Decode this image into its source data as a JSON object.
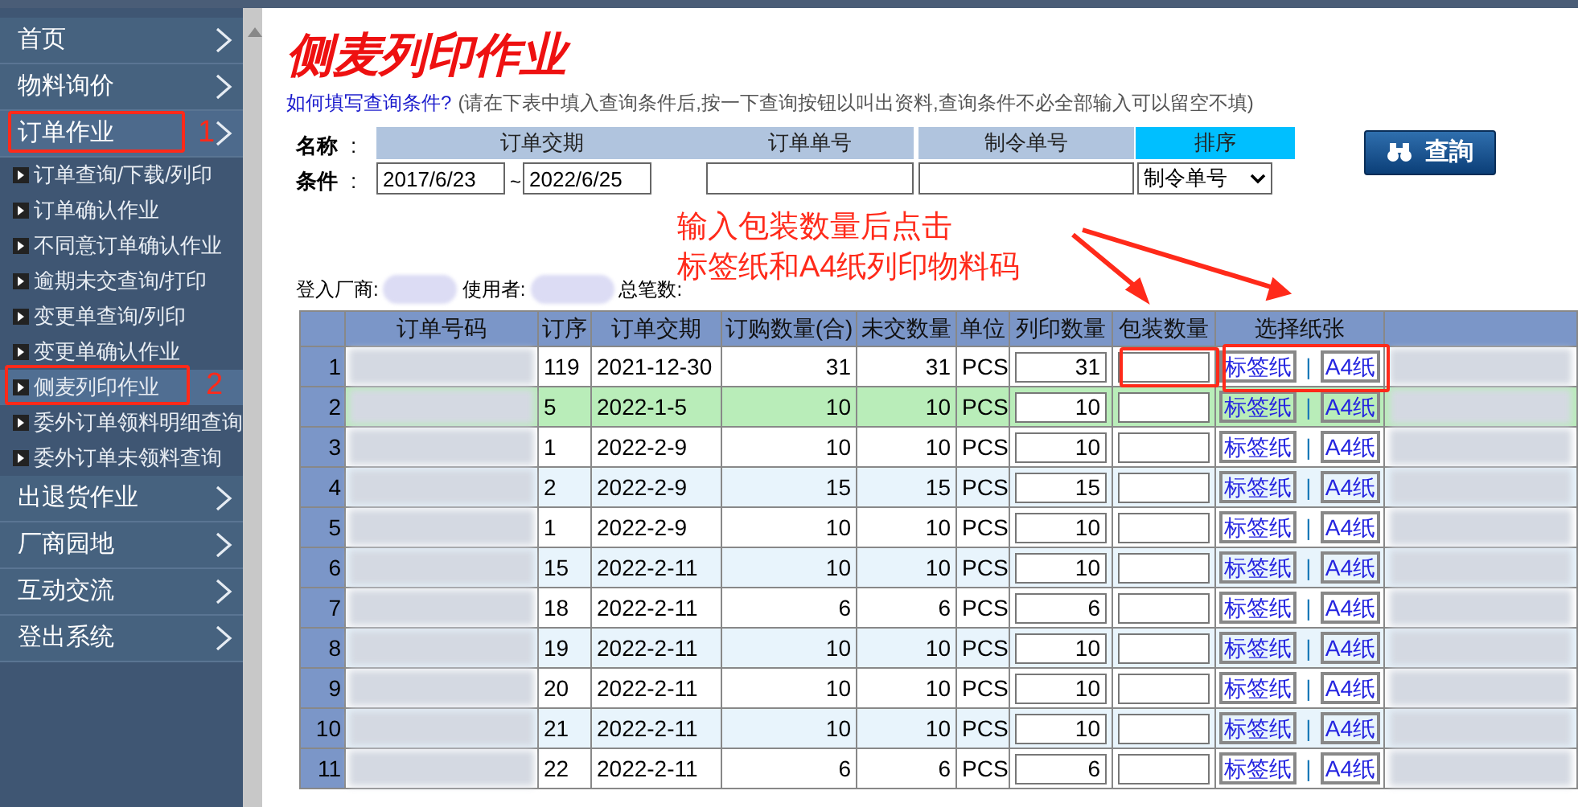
{
  "sidebar": {
    "items": [
      {
        "label": "首页",
        "expanded": false
      },
      {
        "label": "物料询价",
        "expanded": false
      },
      {
        "label": "订单作业",
        "expanded": true,
        "children": [
          {
            "label": "订单查询/下载/列印",
            "selected": false
          },
          {
            "label": "订单确认作业",
            "selected": false
          },
          {
            "label": "不同意订单确认作业",
            "selected": false
          },
          {
            "label": "逾期未交查询/打印",
            "selected": false
          },
          {
            "label": "变更单查询/列印",
            "selected": false
          },
          {
            "label": "变更单确认作业",
            "selected": false
          },
          {
            "label": "侧麦列印作业",
            "selected": true
          },
          {
            "label": "委外订单领料明细查询",
            "selected": false
          },
          {
            "label": "委外订单未领料查询",
            "selected": false
          }
        ]
      },
      {
        "label": "出退货作业",
        "expanded": false
      },
      {
        "label": "厂商园地",
        "expanded": false
      },
      {
        "label": "互动交流",
        "expanded": false
      },
      {
        "label": "登出系统",
        "expanded": false
      }
    ]
  },
  "page_title": "侧麦列印作业",
  "help": {
    "link": "如何填写查询条件?",
    "text": "(请在下表中填入查询条件后,按一下查询按钮以叫出资料,查询条件不必全部输入可以留空不填)"
  },
  "query": {
    "name_label": "名称",
    "condition_label": "条件",
    "separator": ":",
    "headers": [
      "订单交期",
      "订单单号",
      "制令单号",
      "排序"
    ],
    "date_from": "2017/6/23",
    "range_sign": "~",
    "date_to": "2022/6/25",
    "sort": "制令单号",
    "button": "查詢"
  },
  "info": {
    "vendor_label": "登入厂商:",
    "user_label": "使用者:",
    "total_label": "总笔数:"
  },
  "table": {
    "columns": [
      "订单号码",
      "订序",
      "订单交期",
      "订购数量(合)",
      "未交数量",
      "单位",
      "列印数量",
      "包装数量",
      "选择纸张"
    ],
    "rows": [
      {
        "no": "1",
        "seq": "119",
        "due": "2021-12-30",
        "ordered": "31",
        "open": "31",
        "unit": "PCS",
        "print_qty": "31",
        "paper_links": [
          "标签纸",
          "|",
          "A4纸"
        ],
        "highlighted": false
      },
      {
        "no": "2",
        "seq": "5",
        "due": "2022-1-5",
        "ordered": "10",
        "open": "10",
        "unit": "PCS",
        "print_qty": "10",
        "paper_links": [
          "标签纸",
          "|",
          "A4纸"
        ],
        "highlighted": true
      },
      {
        "no": "3",
        "seq": "1",
        "due": "2022-2-9",
        "ordered": "10",
        "open": "10",
        "unit": "PCS",
        "print_qty": "10",
        "paper_links": [
          "标签纸",
          "|",
          "A4纸"
        ],
        "highlighted": false
      },
      {
        "no": "4",
        "seq": "2",
        "due": "2022-2-9",
        "ordered": "15",
        "open": "15",
        "unit": "PCS",
        "print_qty": "15",
        "paper_links": [
          "标签纸",
          "|",
          "A4纸"
        ],
        "highlighted": false
      },
      {
        "no": "5",
        "seq": "1",
        "due": "2022-2-9",
        "ordered": "10",
        "open": "10",
        "unit": "PCS",
        "print_qty": "10",
        "paper_links": [
          "标签纸",
          "|",
          "A4纸"
        ],
        "highlighted": false
      },
      {
        "no": "6",
        "seq": "15",
        "due": "2022-2-11",
        "ordered": "10",
        "open": "10",
        "unit": "PCS",
        "print_qty": "10",
        "paper_links": [
          "标签纸",
          "|",
          "A4纸"
        ],
        "highlighted": false
      },
      {
        "no": "7",
        "seq": "18",
        "due": "2022-2-11",
        "ordered": "6",
        "open": "6",
        "unit": "PCS",
        "print_qty": "6",
        "paper_links": [
          "标签纸",
          "|",
          "A4纸"
        ],
        "highlighted": false
      },
      {
        "no": "8",
        "seq": "19",
        "due": "2022-2-11",
        "ordered": "10",
        "open": "10",
        "unit": "PCS",
        "print_qty": "10",
        "paper_links": [
          "标签纸",
          "|",
          "A4纸"
        ],
        "highlighted": false
      },
      {
        "no": "9",
        "seq": "20",
        "due": "2022-2-11",
        "ordered": "10",
        "open": "10",
        "unit": "PCS",
        "print_qty": "10",
        "paper_links": [
          "标签纸",
          "|",
          "A4纸"
        ],
        "highlighted": false
      },
      {
        "no": "10",
        "seq": "21",
        "due": "2022-2-11",
        "ordered": "10",
        "open": "10",
        "unit": "PCS",
        "print_qty": "10",
        "paper_links": [
          "标签纸",
          "|",
          "A4纸"
        ],
        "highlighted": false
      },
      {
        "no": "11",
        "seq": "22",
        "due": "2022-2-11",
        "ordered": "6",
        "open": "6",
        "unit": "PCS",
        "print_qty": "6",
        "paper_links": [
          "标签纸",
          "|",
          "A4纸"
        ],
        "highlighted": false
      }
    ]
  },
  "annotations": {
    "note_lines": [
      "输入包装数量后点击",
      "标签纸和A4纸列印物料码"
    ],
    "marker_1": "1",
    "marker_2": "2"
  }
}
